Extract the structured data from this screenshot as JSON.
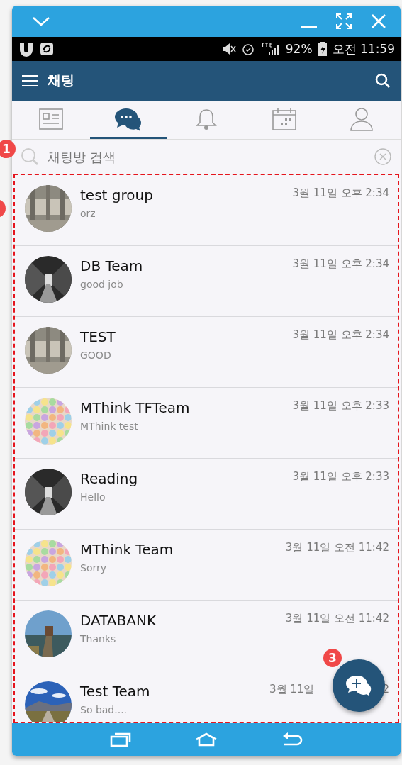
{
  "status_bar": {
    "battery": "92%",
    "time": "오전 11:59"
  },
  "app_bar": {
    "title": "채팅"
  },
  "tabs": [
    {
      "kind": "card",
      "selected": false
    },
    {
      "kind": "chat",
      "selected": true
    },
    {
      "kind": "bell",
      "selected": false
    },
    {
      "kind": "calendar",
      "selected": false
    },
    {
      "kind": "person",
      "selected": false
    }
  ],
  "search": {
    "placeholder": "채팅방 검색"
  },
  "chats": [
    {
      "name": "test group",
      "preview": "orz",
      "time": "3월 11일 오후 2:34",
      "kind": "sign"
    },
    {
      "name": "DB Team",
      "preview": "good job",
      "time": "3월 11일 오후 2:34",
      "kind": "library"
    },
    {
      "name": "TEST",
      "preview": "GOOD",
      "time": "3월 11일 오후 2:34",
      "kind": "sign"
    },
    {
      "name": "MThink TFTeam",
      "preview": "MThink test",
      "time": "3월 11일 오후 2:33",
      "kind": "chalk"
    },
    {
      "name": "Reading",
      "preview": "Hello",
      "time": "3월 11일 오후 2:33",
      "kind": "library"
    },
    {
      "name": "MThink Team",
      "preview": "Sorry",
      "time": "3월 11일 오전 11:42",
      "kind": "chalk"
    },
    {
      "name": "DATABANK",
      "preview": "Thanks",
      "time": "3월 11일 오전 11:42",
      "kind": "lake"
    },
    {
      "name": "Test Team",
      "preview": "So bad....",
      "time": "3월 11일",
      "time_tail": "2",
      "kind": "road"
    }
  ],
  "annotations": [
    {
      "kind": "numbered",
      "label": "1"
    },
    {
      "kind": "cut"
    },
    {
      "kind": "numbered",
      "label": "3"
    }
  ]
}
